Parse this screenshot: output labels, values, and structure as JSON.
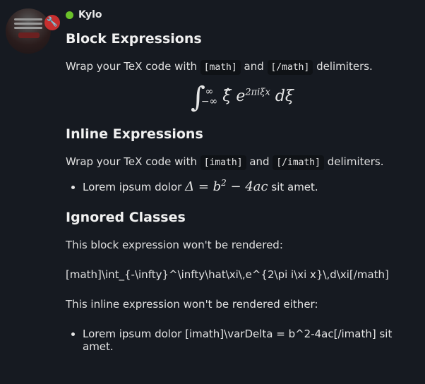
{
  "user": {
    "name": "Kylo",
    "status_color": "#6bc12a",
    "badge_icon": "wrench-icon"
  },
  "sections": {
    "block": {
      "heading": "Block Expressions",
      "text_pre": "Wrap your TeX code with",
      "code_open": "[math]",
      "text_mid": "and",
      "code_close": "[/math]",
      "text_post": "delimiters.",
      "rendered": {
        "base": "∫",
        "lower": "−∞",
        "upper": "∞",
        "body": "ξ̂ e",
        "exp": "2πiξx",
        "tail": " dξ"
      }
    },
    "inline": {
      "heading": "Inline Expressions",
      "text_pre": "Wrap your TeX code with",
      "code_open": "[imath]",
      "text_mid": "and",
      "code_close": "[/imath]",
      "text_post": "delimiters.",
      "item_pre": "Lorem ipsum dolor",
      "math_a": "Δ = b",
      "math_exp": "2",
      "math_b": " − 4ac",
      "item_post": "sit amet."
    },
    "ignored": {
      "heading": "Ignored Classes",
      "block_text": "This block expression won't be rendered:",
      "block_raw": "[math]\\int_{-\\infty}^\\infty\\hat\\xi\\,e^{2\\pi i\\xi x}\\,d\\xi[/math]",
      "inline_text": "This inline expression won't be rendered either:",
      "inline_raw": "Lorem ipsum dolor [imath]\\varDelta = b^2-4ac[/imath] sit amet."
    }
  }
}
